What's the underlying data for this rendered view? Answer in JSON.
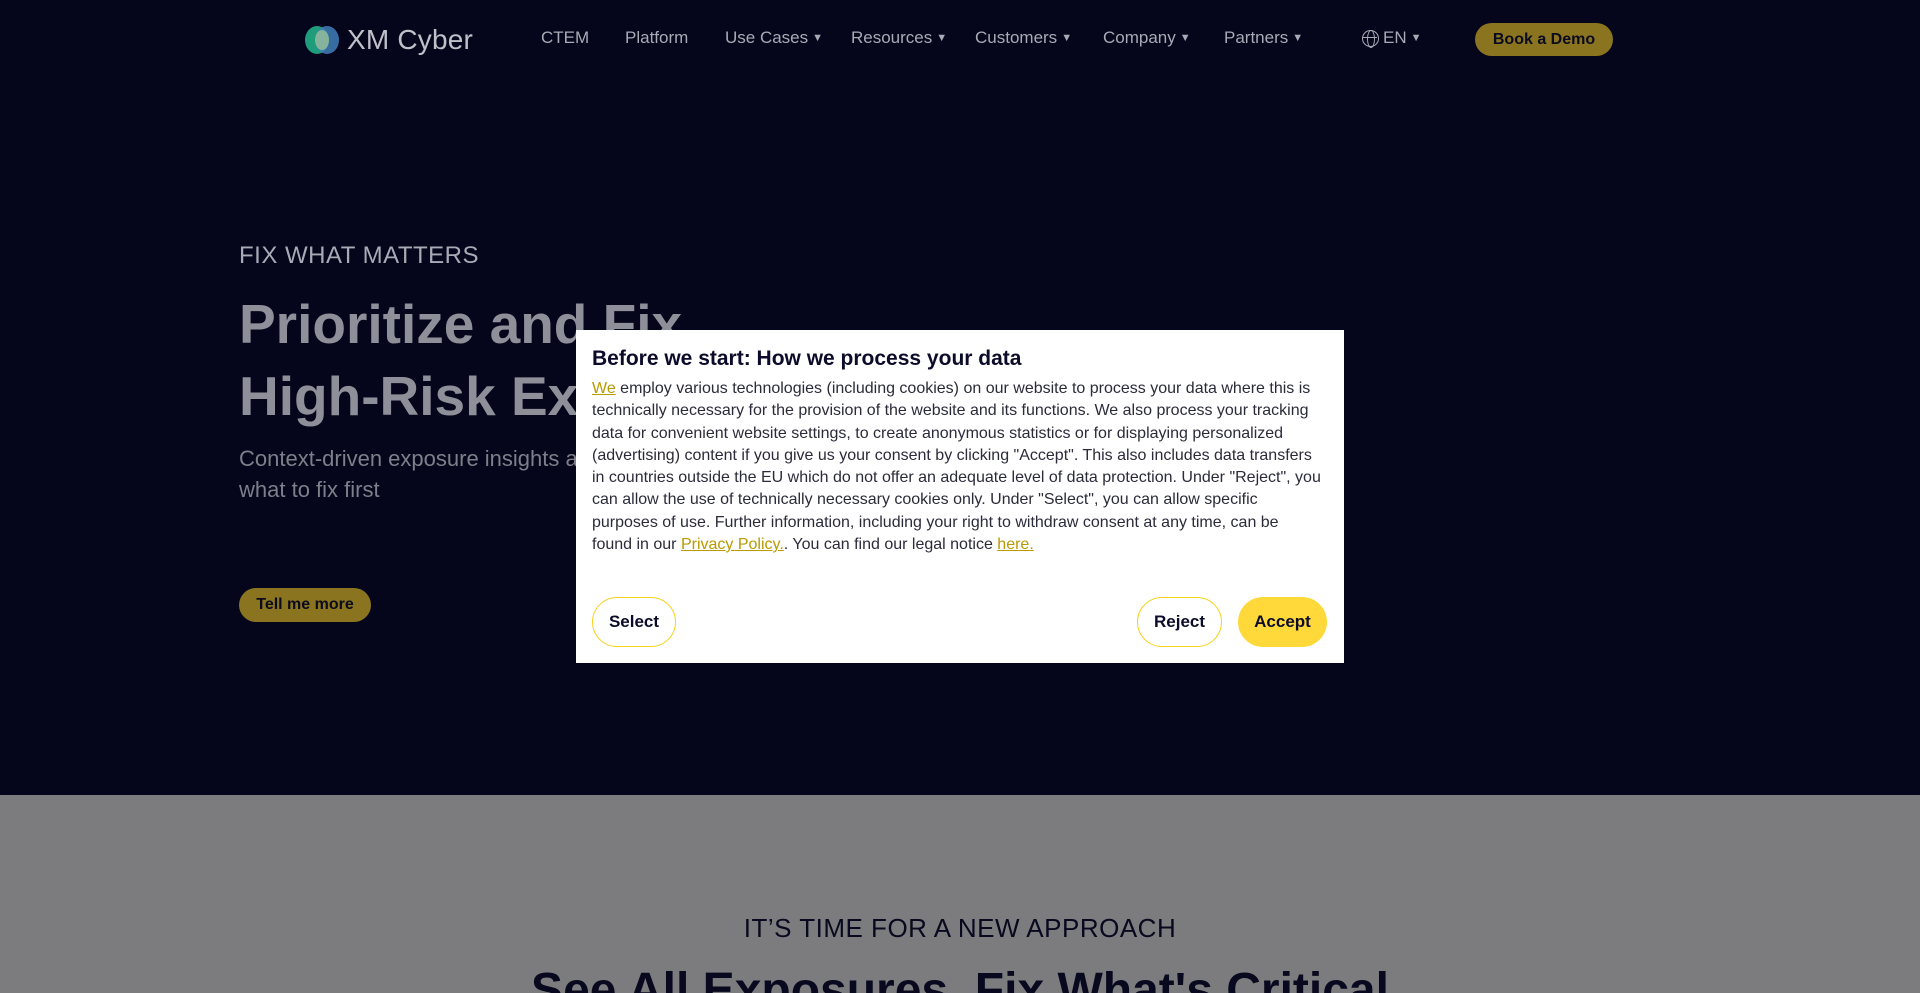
{
  "header": {
    "logo_text": "XM Cyber",
    "nav": [
      {
        "label": "CTEM",
        "caret": false
      },
      {
        "label": "Platform",
        "caret": false
      },
      {
        "label": "Use Cases",
        "caret": true
      },
      {
        "label": "Resources",
        "caret": true
      },
      {
        "label": "Customers",
        "caret": true
      },
      {
        "label": "Company",
        "caret": true
      },
      {
        "label": "Partners",
        "caret": true
      }
    ],
    "language": "EN",
    "cta": "Book a Demo"
  },
  "hero": {
    "eyebrow": "FIX WHAT MATTERS",
    "title_line1": "Prioritize and Fix",
    "title_line2": "High-Risk Exp",
    "subtitle": "Context-driven exposure insights a know what to fix first",
    "button": "Tell me more"
  },
  "section2": {
    "eyebrow": "IT’S TIME FOR A NEW APPROACH",
    "title": "See All Exposures. Fix What's Critical"
  },
  "consent": {
    "title": "Before we start: How we process your data",
    "link_we": "We",
    "body_1": " employ various technologies (including cookies) on our website to process your data where this is technically necessary for the provision of the website and its functions. We also process your tracking data for convenient website settings, to create anonymous statistics or for displaying personalized (advertising) content if you give us your consent by clicking \"Accept\". This also includes data transfers in countries outside the EU which do not offer an adequate level of data protection. Under \"Reject\", you can allow the use of technically necessary cookies only. Under \"Select\", you can allow specific purposes of use. Further information, including your right to withdraw consent at any time, can be found in our ",
    "link_privacy": "Privacy Policy.",
    "body_2": ". You can find our legal notice ",
    "link_here": "here.",
    "select": "Select",
    "reject": "Reject",
    "accept": "Accept"
  },
  "colors": {
    "background": "#05051b",
    "accent": "#ffd93a",
    "dimmed_accent": "#8a7420"
  }
}
